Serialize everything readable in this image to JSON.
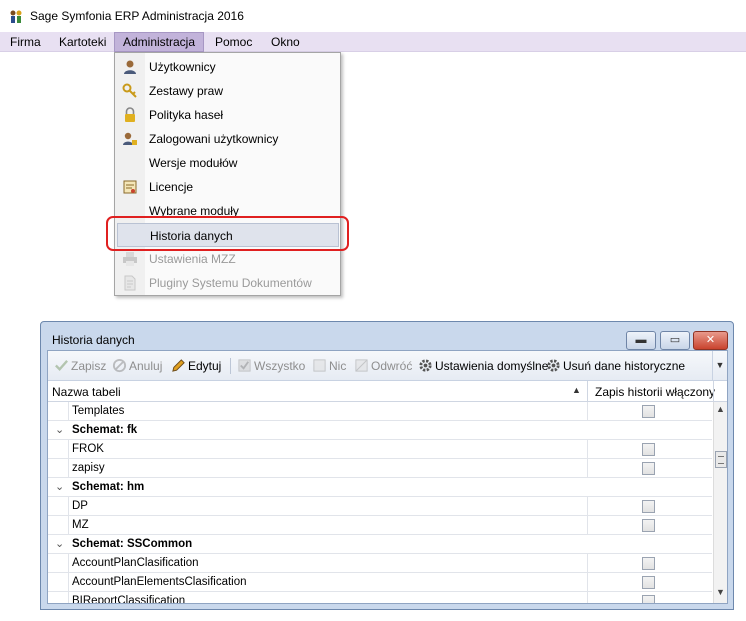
{
  "app": {
    "title": "Sage Symfonia ERP Administracja 2016",
    "logo_icon": "sage-logo-icon"
  },
  "menubar": {
    "items": [
      "Firma",
      "Kartoteki",
      "Administracja",
      "Pomoc",
      "Okno"
    ],
    "active": "Administracja"
  },
  "admin_menu": {
    "items": [
      {
        "label": "Użytkownicy",
        "icon": "user-icon",
        "enabled": true
      },
      {
        "label": "Zestawy praw",
        "icon": "keys-icon",
        "enabled": true
      },
      {
        "label": "Polityka haseł",
        "icon": "padlock-icon",
        "enabled": true
      },
      {
        "label": "Zalogowani użytkownicy",
        "icon": "user-lock-icon",
        "enabled": true
      },
      {
        "label": "Wersje modułów",
        "icon": "",
        "enabled": true
      },
      {
        "label": "Licencje",
        "icon": "license-icon",
        "enabled": true
      },
      {
        "label": "Wybrane moduły",
        "icon": "",
        "enabled": true
      },
      {
        "label": "Historia danych",
        "icon": "",
        "enabled": true,
        "highlighted": true
      },
      {
        "label": "Ustawienia MZZ",
        "icon": "printer-icon",
        "enabled": false
      },
      {
        "label": "Pluginy Systemu Dokumentów",
        "icon": "document-icon",
        "enabled": false
      }
    ]
  },
  "history_window": {
    "title": "Historia danych",
    "toolbar": {
      "save": "Zapisz",
      "cancel": "Anuluj",
      "edit": "Edytuj",
      "all": "Wszystko",
      "none": "Nic",
      "invert": "Odwróć",
      "default_settings": "Ustawienia domyślne",
      "delete_history": "Usuń dane historyczne"
    },
    "columns": {
      "name": "Nazwa tabeli",
      "history": "Zapis historii włączony"
    },
    "rows": [
      {
        "type": "data",
        "name": "Templates"
      },
      {
        "type": "group",
        "name": "Schemat: fk"
      },
      {
        "type": "data",
        "name": "FROK"
      },
      {
        "type": "data",
        "name": "zapisy"
      },
      {
        "type": "group",
        "name": "Schemat: hm"
      },
      {
        "type": "data",
        "name": "DP"
      },
      {
        "type": "data",
        "name": "MZ"
      },
      {
        "type": "group",
        "name": "Schemat: SSCommon"
      },
      {
        "type": "data",
        "name": "AccountPlanClasification"
      },
      {
        "type": "data",
        "name": "AccountPlanElementsClasification"
      },
      {
        "type": "data",
        "name": "BIReportClassification"
      }
    ]
  },
  "colors": {
    "menubar_bg": "#e8e0f2",
    "menu_active": "#c2b3da",
    "window_frame": "#c9d8ec",
    "highlight_ring": "#e02020"
  }
}
